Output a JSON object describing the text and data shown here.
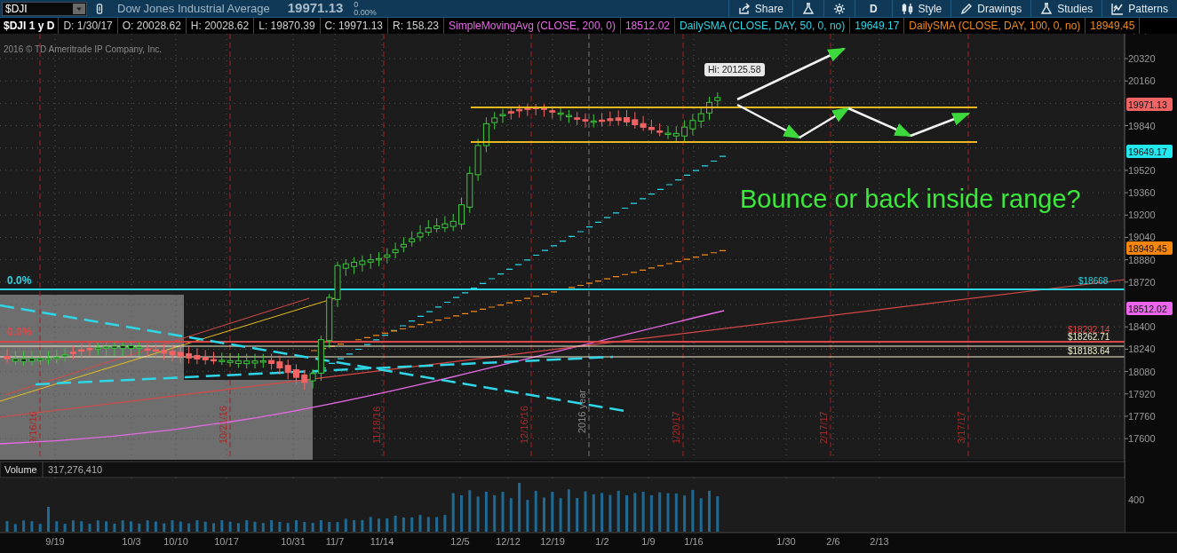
{
  "toolbar": {
    "symbol": "$DJI",
    "description": "Dow Jones Industrial Average",
    "last_price": "19971.13",
    "change": "0",
    "change_percent": "0.00%",
    "buttons": [
      {
        "kind": "share",
        "label": "Share"
      },
      {
        "kind": "flask"
      },
      {
        "kind": "gear"
      },
      {
        "kind": "text",
        "label": "D"
      },
      {
        "kind": "style",
        "label": "Style"
      },
      {
        "kind": "drawings",
        "label": "Drawings"
      },
      {
        "kind": "studies",
        "label": "Studies"
      },
      {
        "kind": "patterns",
        "label": "Patterns"
      }
    ]
  },
  "legend": {
    "title": "$DJI 1 y D",
    "fields": [
      "D: 1/30/17",
      "O: 20028.62",
      "H: 20028.62",
      "L: 19870.39",
      "C: 19971.13",
      "R: 158.23"
    ],
    "studies": [
      {
        "name": "SimpleMovingAvg (CLOSE, 200, 0)",
        "value": "18512.02",
        "color": "#e86ae8"
      },
      {
        "name": "DailySMA (CLOSE, DAY, 50, 0, no)",
        "value": "19649.17",
        "color": "#2fd6e6"
      },
      {
        "name": "DailySMA (CLOSE, DAY, 100, 0, no)",
        "value": "18949.45",
        "color": "#f08a1c"
      }
    ]
  },
  "price_chart": {
    "copyright": "2016 © TD Ameritrade IP Company, Inc.",
    "y_axis_labels": [
      "20320",
      "20160",
      "19840",
      "19520",
      "19360",
      "19200",
      "19040",
      "18880",
      "18720",
      "18400",
      "18240",
      "18080",
      "17920",
      "17760",
      "17600"
    ],
    "price_badges": [
      {
        "value": "19971.13",
        "color": "#f26464"
      },
      {
        "value": "19649.17",
        "color": "#22e8f0"
      },
      {
        "value": "18949.45",
        "color": "#f7860f"
      },
      {
        "value": "18512.02",
        "color": "#ee66ee"
      }
    ],
    "event_labels": [
      "9/16/16",
      "10/21/16",
      "11/18/16",
      "12/16/16",
      "1/20/17",
      "2/17/17",
      "3/17/17"
    ],
    "year_marker": "2016 year",
    "high_label": "Hi: 20125.58",
    "fib_labels": [
      {
        "text": "0.0%",
        "color": "#2fd6e6"
      },
      {
        "text": "0.0%",
        "color": "#e04848"
      }
    ],
    "level_labels": [
      {
        "text": "$18668",
        "color": "#2fd6e6"
      },
      {
        "text": "$18292.14",
        "color": "#d84848"
      },
      {
        "text": "$18262.71",
        "color": "#f4f0d0"
      },
      {
        "text": "$18183.64",
        "color": "#f4f0d0"
      }
    ],
    "annotation": "Bounce or back inside range?"
  },
  "volume": {
    "title": "Volume",
    "value": "317,276,410",
    "y_axis_labels": [
      "400"
    ]
  },
  "x_axis_labels": [
    "9/19",
    "10/3",
    "10/10",
    "10/17",
    "10/31",
    "11/7",
    "11/14",
    "12/5",
    "12/12",
    "12/19",
    "1/2",
    "1/9",
    "1/16",
    "1/30",
    "2/6",
    "2/13"
  ]
}
